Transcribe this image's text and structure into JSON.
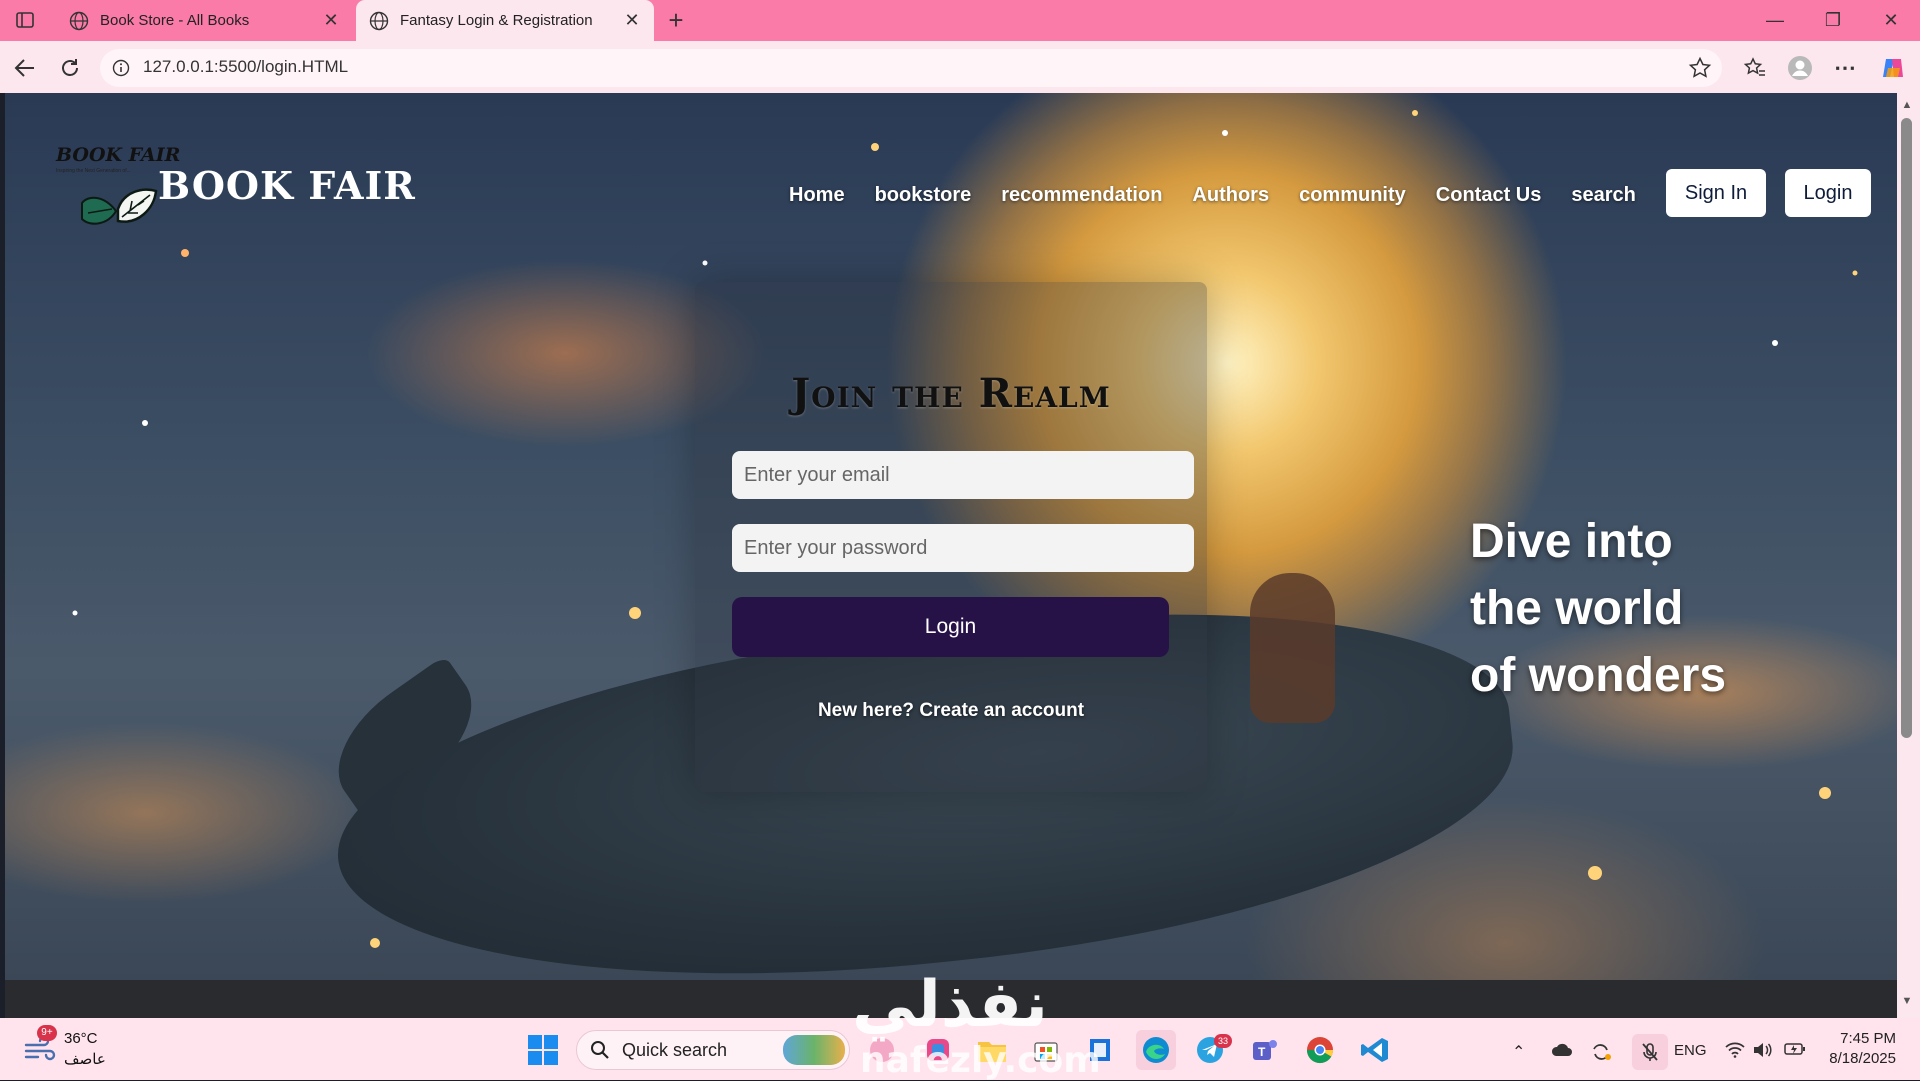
{
  "browser": {
    "tabs": [
      {
        "title": "Book Store - All Books",
        "active": false
      },
      {
        "title": "Fantasy Login & Registration",
        "active": true
      }
    ],
    "url": "127.0.0.1:5500/login.HTML"
  },
  "site": {
    "logo_script": "BOOK FAIR",
    "logo_tagline": "Inspiring the Next Generation of...",
    "logo_title": "BOOK FAIR",
    "nav": [
      "Home",
      "bookstore",
      "recommendation",
      "Authors",
      "community",
      "Contact Us",
      "search"
    ],
    "sign_in_label": "Sign In",
    "login_label": "Login"
  },
  "login_form": {
    "title": "Join the Realm",
    "email_placeholder": "Enter your email",
    "password_placeholder": "Enter your password",
    "submit_label": "Login",
    "register_link": "New here? Create an account"
  },
  "hero": {
    "tagline_lines": [
      "Dive into",
      "the world",
      "of wonders"
    ]
  },
  "taskbar": {
    "weather_badge": "9+",
    "weather_temp": "36°C",
    "weather_condition": "عاصف",
    "search_label": "Quick search",
    "telegram_badge": "33",
    "language": "ENG",
    "time": "7:45 PM",
    "date": "8/18/2025"
  },
  "watermark": {
    "arabic": "نفذلي",
    "latin": "nafezly.com"
  },
  "colors": {
    "tab_strip": "#fa7ba7",
    "toolbar": "#fde7ef",
    "login_button": "#271248",
    "taskbar": "#ffe3ed"
  }
}
